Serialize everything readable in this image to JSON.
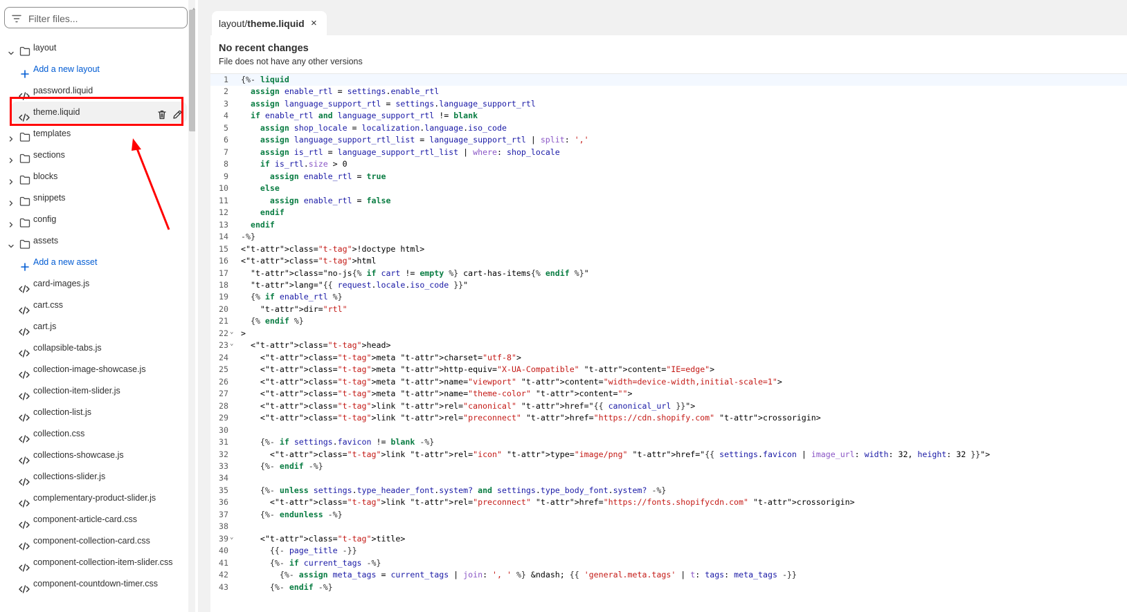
{
  "filter": {
    "placeholder": "Filter files..."
  },
  "tree": [
    {
      "type": "folder",
      "label": "layout",
      "expanded": true
    },
    {
      "type": "add",
      "label": "Add a new layout"
    },
    {
      "type": "file",
      "label": "password.liquid"
    },
    {
      "type": "file",
      "label": "theme.liquid",
      "selected": true
    },
    {
      "type": "folder",
      "label": "templates",
      "expanded": false
    },
    {
      "type": "folder",
      "label": "sections",
      "expanded": false
    },
    {
      "type": "folder",
      "label": "blocks",
      "expanded": false
    },
    {
      "type": "folder",
      "label": "snippets",
      "expanded": false
    },
    {
      "type": "folder",
      "label": "config",
      "expanded": false
    },
    {
      "type": "folder",
      "label": "assets",
      "expanded": true
    },
    {
      "type": "add",
      "label": "Add a new asset"
    },
    {
      "type": "file",
      "label": "card-images.js"
    },
    {
      "type": "file",
      "label": "cart.css"
    },
    {
      "type": "file",
      "label": "cart.js"
    },
    {
      "type": "file",
      "label": "collapsible-tabs.js"
    },
    {
      "type": "file",
      "label": "collection-image-showcase.js"
    },
    {
      "type": "file",
      "label": "collection-item-slider.js"
    },
    {
      "type": "file",
      "label": "collection-list.js"
    },
    {
      "type": "file",
      "label": "collection.css"
    },
    {
      "type": "file",
      "label": "collections-showcase.js"
    },
    {
      "type": "file",
      "label": "collections-slider.js"
    },
    {
      "type": "file",
      "label": "complementary-product-slider.js"
    },
    {
      "type": "file",
      "label": "component-article-card.css"
    },
    {
      "type": "file",
      "label": "component-collection-card.css"
    },
    {
      "type": "file",
      "label": "component-collection-item-slider.css"
    },
    {
      "type": "file",
      "label": "component-countdown-timer.css"
    }
  ],
  "tab": {
    "folder": "layout/",
    "file": "theme.liquid",
    "close": "×"
  },
  "changes": {
    "title": "No recent changes",
    "subtitle": "File does not have any other versions"
  },
  "code_lines": [
    "{%- liquid",
    "  assign enable_rtl = settings.enable_rtl",
    "  assign language_support_rtl = settings.language_support_rtl",
    "  if enable_rtl and language_support_rtl != blank",
    "    assign shop_locale = localization.language.iso_code",
    "    assign language_support_rtl_list = language_support_rtl | split: ','",
    "    assign is_rtl = language_support_rtl_list | where: shop_locale",
    "    if is_rtl.size > 0",
    "      assign enable_rtl = true",
    "    else",
    "      assign enable_rtl = false",
    "    endif",
    "  endif",
    "-%}",
    "<!doctype html>",
    "<html",
    "  class=\"no-js{% if cart != empty %} cart-has-items{% endif %}\"",
    "  lang=\"{{ request.locale.iso_code }}\"",
    "  {% if enable_rtl %}",
    "    dir=\"rtl\"",
    "  {% endif %}",
    ">",
    "  <head>",
    "    <meta charset=\"utf-8\">",
    "    <meta http-equiv=\"X-UA-Compatible\" content=\"IE=edge\">",
    "    <meta name=\"viewport\" content=\"width=device-width,initial-scale=1\">",
    "    <meta name=\"theme-color\" content=\"\">",
    "    <link rel=\"canonical\" href=\"{{ canonical_url }}\">",
    "    <link rel=\"preconnect\" href=\"https://cdn.shopify.com\" crossorigin>",
    "",
    "    {%- if settings.favicon != blank -%}",
    "      <link rel=\"icon\" type=\"image/png\" href=\"{{ settings.favicon | image_url: width: 32, height: 32 }}\">",
    "    {%- endif -%}",
    "",
    "    {%- unless settings.type_header_font.system? and settings.type_body_font.system? -%}",
    "      <link rel=\"preconnect\" href=\"https://fonts.shopifycdn.com\" crossorigin>",
    "    {%- endunless -%}",
    "",
    "    <title>",
    "      {{- page_title -}}",
    "      {%- if current_tags -%}",
    "        {%- assign meta_tags = current_tags | join: ', ' %} &ndash; {{ 'general.meta.tags' | t: tags: meta_tags -}}",
    "      {%- endif -%}"
  ],
  "fold_markers": [
    22,
    23,
    39
  ],
  "active_line": 1
}
